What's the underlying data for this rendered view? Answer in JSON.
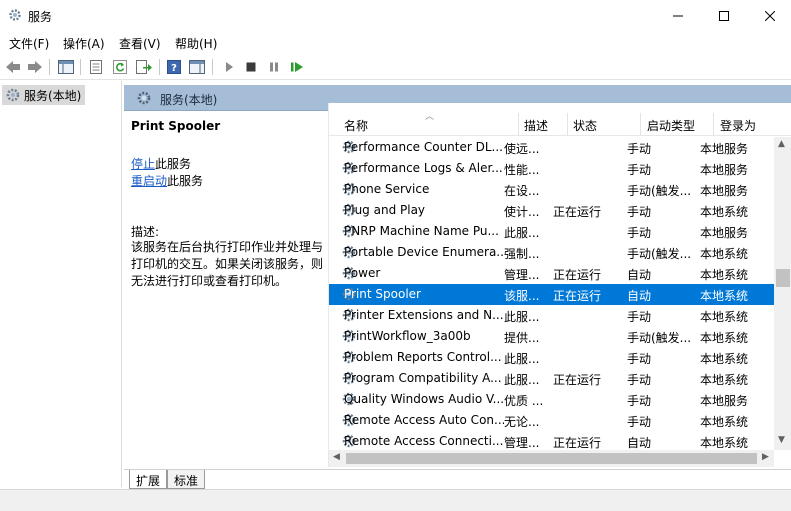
{
  "window": {
    "title": "服务"
  },
  "menu": [
    {
      "label": "文件(F)"
    },
    {
      "label": "操作(A)"
    },
    {
      "label": "查看(V)"
    },
    {
      "label": "帮助(H)"
    }
  ],
  "toolbar": [
    "back-icon",
    "forward-icon",
    "show-hide-tree-icon",
    "properties-icon",
    "refresh-icon",
    "export-list-icon",
    "help-icon",
    "show-hide-action-pane-icon",
    "start-service-icon",
    "stop-service-icon",
    "pause-service-icon",
    "restart-service-icon"
  ],
  "tree": {
    "root": "服务(本地)"
  },
  "pane_header": "服务(本地)",
  "description": {
    "service_name": "Print Spooler",
    "stop_link": "停止",
    "stop_suffix": "此服务",
    "restart_link": "重启动",
    "restart_suffix": "此服务",
    "desc_label": "描述:",
    "desc_text": "该服务在后台执行打印作业并处理与打印机的交互。如果关闭该服务，则无法进行打印或查看打印机。"
  },
  "list": {
    "columns": [
      "名称",
      "描述",
      "状态",
      "启动类型",
      "登录为"
    ],
    "rows": [
      {
        "name": "Performance Counter DL...",
        "desc": "使远...",
        "status": "",
        "startup": "手动",
        "logon": "本地服务"
      },
      {
        "name": "Performance Logs & Aler...",
        "desc": "性能...",
        "status": "",
        "startup": "手动",
        "logon": "本地服务"
      },
      {
        "name": "Phone Service",
        "desc": "在设...",
        "status": "",
        "startup": "手动(触发...",
        "logon": "本地服务"
      },
      {
        "name": "Plug and Play",
        "desc": "使计...",
        "status": "正在运行",
        "startup": "手动",
        "logon": "本地系统"
      },
      {
        "name": "PNRP Machine Name Pu...",
        "desc": "此服...",
        "status": "",
        "startup": "手动",
        "logon": "本地服务"
      },
      {
        "name": "Portable Device Enumera...",
        "desc": "强制...",
        "status": "",
        "startup": "手动(触发...",
        "logon": "本地系统"
      },
      {
        "name": "Power",
        "desc": "管理...",
        "status": "正在运行",
        "startup": "自动",
        "logon": "本地系统"
      },
      {
        "name": "Print Spooler",
        "desc": "该服...",
        "status": "正在运行",
        "startup": "自动",
        "logon": "本地系统",
        "selected": true
      },
      {
        "name": "Printer Extensions and N...",
        "desc": "此服...",
        "status": "",
        "startup": "手动",
        "logon": "本地系统"
      },
      {
        "name": "PrintWorkflow_3a00b",
        "desc": "提供...",
        "status": "",
        "startup": "手动(触发...",
        "logon": "本地系统"
      },
      {
        "name": "Problem Reports Control...",
        "desc": "此服...",
        "status": "",
        "startup": "手动",
        "logon": "本地系统"
      },
      {
        "name": "Program Compatibility A...",
        "desc": "此服...",
        "status": "正在运行",
        "startup": "手动",
        "logon": "本地系统"
      },
      {
        "name": "Quality Windows Audio V...",
        "desc": "优质 ...",
        "status": "",
        "startup": "手动",
        "logon": "本地服务"
      },
      {
        "name": "Remote Access Auto Con...",
        "desc": "无论...",
        "status": "",
        "startup": "手动",
        "logon": "本地系统"
      },
      {
        "name": "Remote Access Connecti...",
        "desc": "管理...",
        "status": "正在运行",
        "startup": "自动",
        "logon": "本地系统"
      }
    ]
  },
  "tabs": [
    {
      "label": "扩展",
      "active": true
    },
    {
      "label": "标准",
      "active": false
    }
  ],
  "colors": {
    "selection": "#0078d7",
    "header": "#a5bdd6",
    "link": "#1a5bc6"
  }
}
